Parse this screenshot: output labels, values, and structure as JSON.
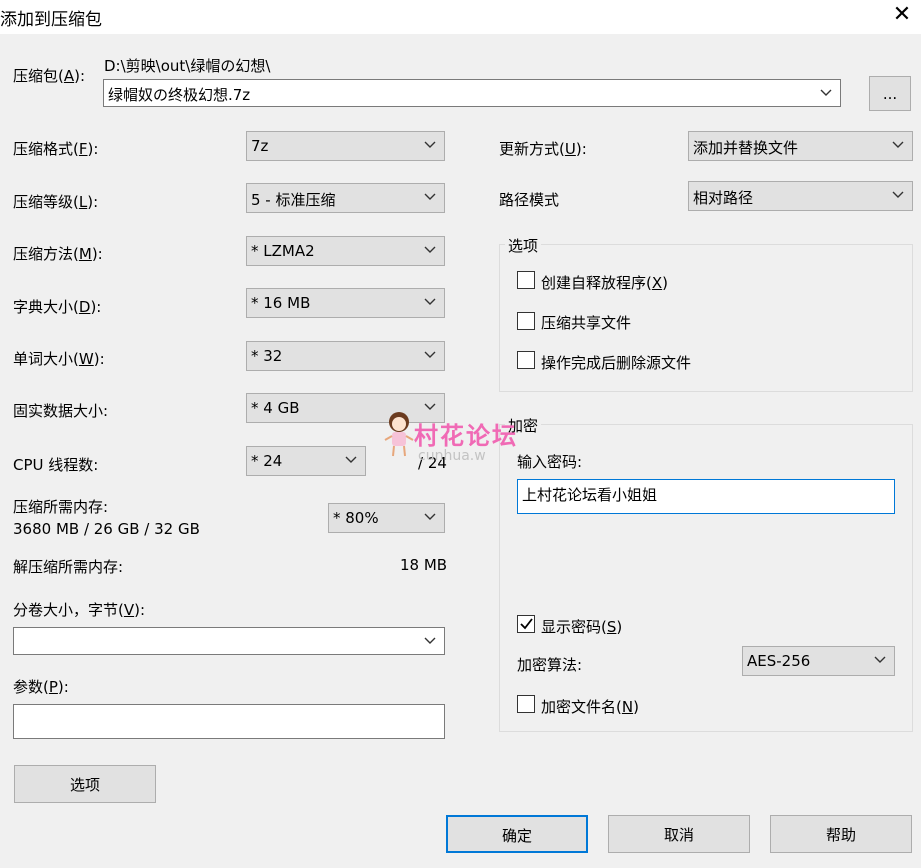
{
  "window": {
    "title": "添加到压缩包",
    "close_glyph": "✕"
  },
  "archive": {
    "label": "压缩包",
    "hotkey": "A",
    "path": "D:\\剪映\\out\\绿帽の幻想\\",
    "filename": "绿帽奴の终极幻想.7z",
    "browse_label": "..."
  },
  "left": {
    "format": {
      "label": "压缩格式",
      "hotkey": "F",
      "value": "7z"
    },
    "level": {
      "label": "压缩等级",
      "hotkey": "L",
      "value": "5 - 标准压缩"
    },
    "method": {
      "label": "压缩方法",
      "hotkey": "M",
      "value": "*  LZMA2"
    },
    "dict": {
      "label": "字典大小",
      "hotkey": "D",
      "value": "*  16 MB"
    },
    "word": {
      "label": "单词大小",
      "hotkey": "W",
      "value": "*  32"
    },
    "solid": {
      "label": "固实数据大小",
      "value": "*  4 GB"
    },
    "cpu": {
      "label": "CPU 线程数",
      "value": "*  24",
      "total": "/ 24"
    },
    "mem_comp": {
      "label": "压缩所需内存",
      "detail": "3680 MB / 26 GB / 32 GB",
      "value": "* 80%"
    },
    "mem_decomp": {
      "label": "解压缩所需内存",
      "value": "18 MB"
    },
    "volume": {
      "label": "分卷大小，字节",
      "hotkey": "V",
      "value": ""
    },
    "params": {
      "label": "参数",
      "hotkey": "P",
      "value": ""
    },
    "options_button": "选项"
  },
  "right": {
    "update": {
      "label": "更新方式",
      "hotkey": "U",
      "value": "添加并替换文件"
    },
    "path_mode": {
      "label": "路径模式",
      "value": "相对路径"
    },
    "options_group": {
      "title": "选项",
      "sfx": {
        "label": "创建自释放程序",
        "hotkey": "X",
        "checked": false
      },
      "shared": {
        "label": "压缩共享文件",
        "checked": false
      },
      "delete": {
        "label": "操作完成后删除源文件",
        "checked": false
      }
    },
    "encryption": {
      "title": "加密",
      "password_label": "输入密码",
      "password_value": "上村花论坛看小姐姐",
      "show_password": {
        "label": "显示密码",
        "hotkey": "S",
        "checked": true
      },
      "method_label": "加密算法",
      "method_value": "AES-256",
      "encrypt_names": {
        "label": "加密文件名",
        "hotkey": "N",
        "checked": false
      }
    }
  },
  "buttons": {
    "ok": "确定",
    "cancel": "取消",
    "help": "帮助"
  },
  "watermark": {
    "text": "村花论坛",
    "url": "cunhua.w"
  },
  "colors": {
    "accent": "#0078d7",
    "watermark": "#f06ab5"
  }
}
